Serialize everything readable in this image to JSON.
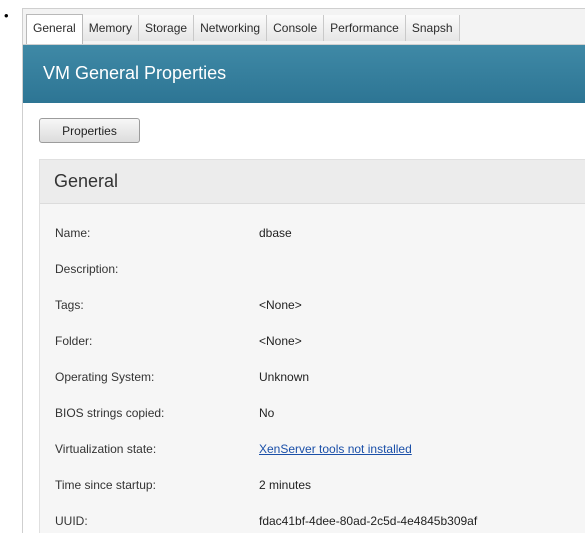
{
  "tabs": [
    {
      "label": "General",
      "active": true
    },
    {
      "label": "Memory",
      "active": false
    },
    {
      "label": "Storage",
      "active": false
    },
    {
      "label": "Networking",
      "active": false
    },
    {
      "label": "Console",
      "active": false
    },
    {
      "label": "Performance",
      "active": false
    },
    {
      "label": "Snapsh",
      "active": false
    }
  ],
  "header": {
    "title": "VM General Properties",
    "color": "#347d9c"
  },
  "toolbar": {
    "properties_label": "Properties"
  },
  "general": {
    "title": "General",
    "rows": [
      {
        "label": "Name:",
        "value": "dbase"
      },
      {
        "label": "Description:",
        "value": ""
      },
      {
        "label": "Tags:",
        "value": "<None>"
      },
      {
        "label": "Folder:",
        "value": "<None>"
      },
      {
        "label": "Operating System:",
        "value": "Unknown"
      },
      {
        "label": "BIOS strings copied:",
        "value": "No"
      },
      {
        "label": "Virtualization state:",
        "value": "XenServer tools not installed"
      },
      {
        "label": "Time since startup:",
        "value": "2 minutes"
      },
      {
        "label": "UUID:",
        "value": "fdac41bf-4dee-80ad-2c5d-4e4845b309af"
      }
    ]
  }
}
